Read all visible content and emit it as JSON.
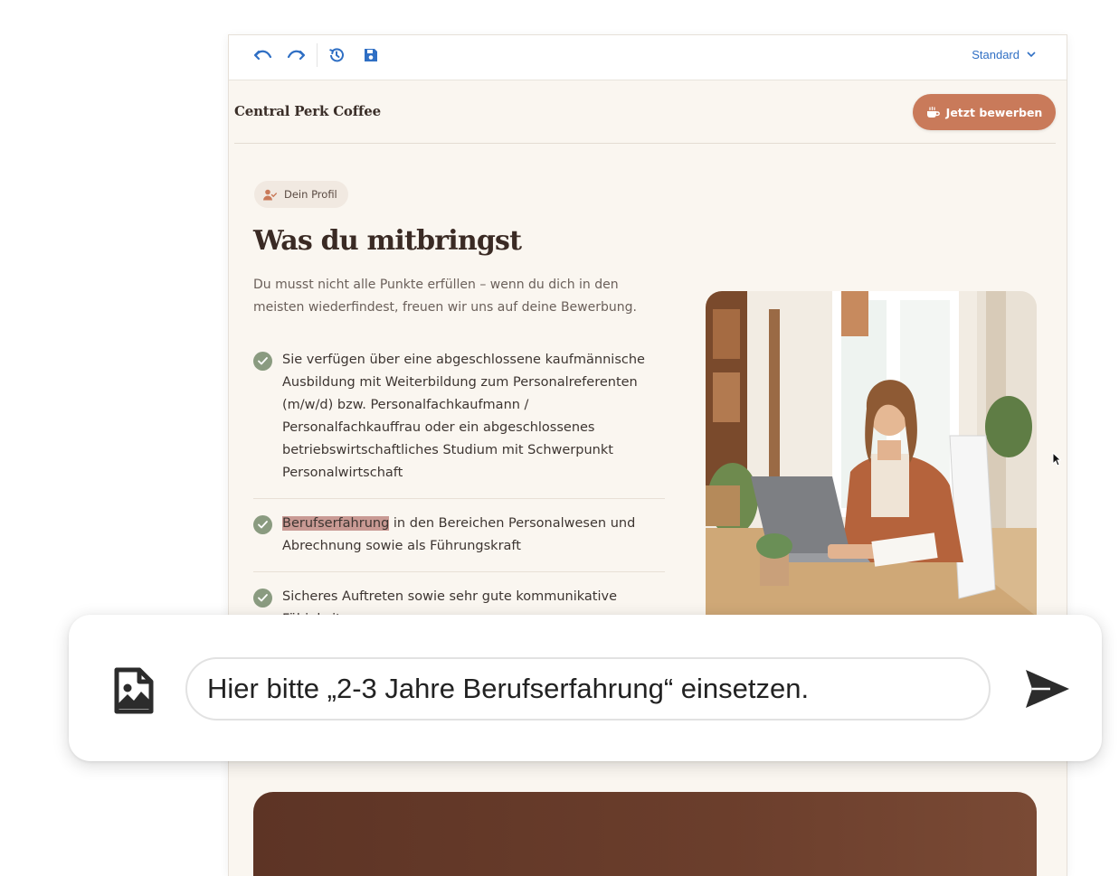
{
  "toolbar": {
    "view_mode": "Standard",
    "icons": [
      "undo-icon",
      "redo-icon",
      "history-icon",
      "save-icon",
      "chevron-down-icon"
    ]
  },
  "site": {
    "brand": "Central Perk Coffee",
    "cta_label": "Jetzt bewerben"
  },
  "section": {
    "badge": "Dein Profil",
    "heading": "Was du mitbringst",
    "intro": "Du musst nicht alle Punkte erfüllen – wenn du dich in den meisten wiederfindest, freuen wir uns auf deine Bewerbung.",
    "requirements": [
      {
        "text": "Sie verfügen über eine abgeschlossene kaufmännische Ausbildung mit Weiterbildung zum Personalreferenten (m/w/d) bzw. Personalfachkaufmann / Personalfachkauffrau oder ein abgeschlossenes betriebswirtschaftliches Studium mit Schwerpunkt Personalwirtschaft"
      },
      {
        "highlight": "Berufserfahrung",
        "text": " in den Bereichen Personalwesen und Abrechnung sowie als Führungskraft"
      },
      {
        "text": "Sicheres Auftreten sowie sehr gute kommunikative Fähigkeiten"
      }
    ]
  },
  "chat": {
    "message": "Hier bitte „2-3 Jahre Berufserfahrung“ einsetzen."
  },
  "colors": {
    "accent": "#c97a5a",
    "check": "#8a9b80",
    "toolbar_icon": "#2f6fc4",
    "highlight": "#c99a94",
    "dark_card": "#5d3425",
    "page_bg": "#faf6f0"
  }
}
